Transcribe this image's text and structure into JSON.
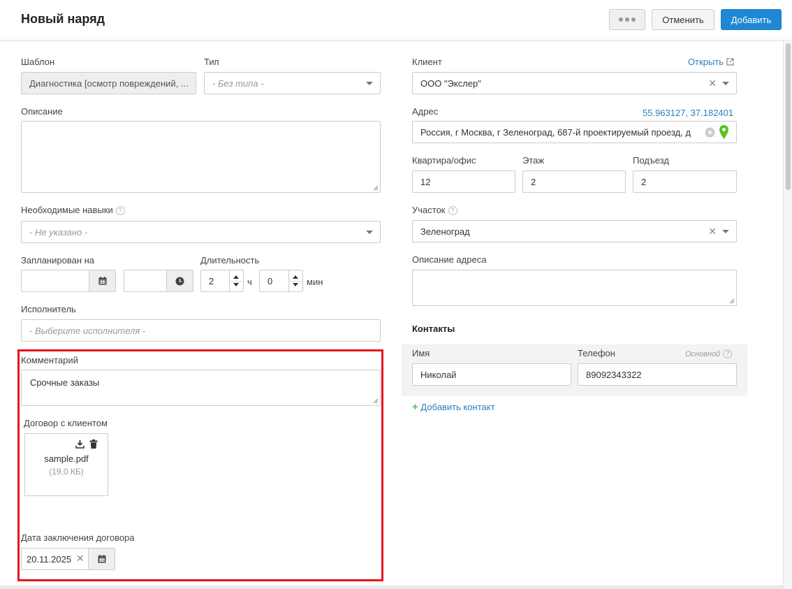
{
  "header": {
    "title": "Новый наряд",
    "cancel_label": "Отменить",
    "add_label": "Добавить"
  },
  "left": {
    "template": {
      "label": "Шаблон",
      "value": "Диагностика [осмотр повреждений, ..."
    },
    "type": {
      "label": "Тип",
      "placeholder": "- Без типа -"
    },
    "description": {
      "label": "Описание",
      "value": ""
    },
    "skills": {
      "label": "Необходимые навыки",
      "placeholder": "- Не указано -"
    },
    "planned": {
      "label": "Запланирован на",
      "date_value": "",
      "time_value": ""
    },
    "duration": {
      "label": "Длительность",
      "hours": "2",
      "hours_unit": "ч",
      "minutes": "0",
      "minutes_unit": "мин"
    },
    "executor": {
      "label": "Исполнитель",
      "placeholder": "- Выберите исполнителя -"
    },
    "comment": {
      "label": "Комментарий",
      "value": "Срочные заказы"
    },
    "contract": {
      "label": "Договор с клиентом",
      "file_name": "sample.pdf",
      "file_size": "(19,0 КБ)"
    },
    "contract_date": {
      "label": "Дата заключения договора",
      "value": "20.11.2025"
    }
  },
  "right": {
    "client": {
      "label": "Клиент",
      "open_link": "Открыть",
      "value": "ООО \"Экслер\""
    },
    "address": {
      "label": "Адрес",
      "coords": "55.963127, 37.182401",
      "value": "Россия, г Москва, г Зеленоград, 687-й проектируемый проезд, д"
    },
    "apartment": {
      "label": "Квартира/офис",
      "value": "12"
    },
    "floor": {
      "label": "Этаж",
      "value": "2"
    },
    "entrance": {
      "label": "Подъезд",
      "value": "2"
    },
    "district": {
      "label": "Участок",
      "value": "Зеленоград"
    },
    "address_desc": {
      "label": "Описание адреса",
      "value": ""
    },
    "contacts": {
      "title": "Контакты",
      "name_label": "Имя",
      "phone_label": "Телефон",
      "primary_label": "Основной",
      "name_value": "Николай",
      "phone_value": "89092343322",
      "add_label": "Добавить контакт"
    }
  },
  "colors": {
    "accent": "#1e88d4",
    "link": "#2a7fc1",
    "highlight": "#e8141c",
    "map_pin": "#5cc21f"
  }
}
